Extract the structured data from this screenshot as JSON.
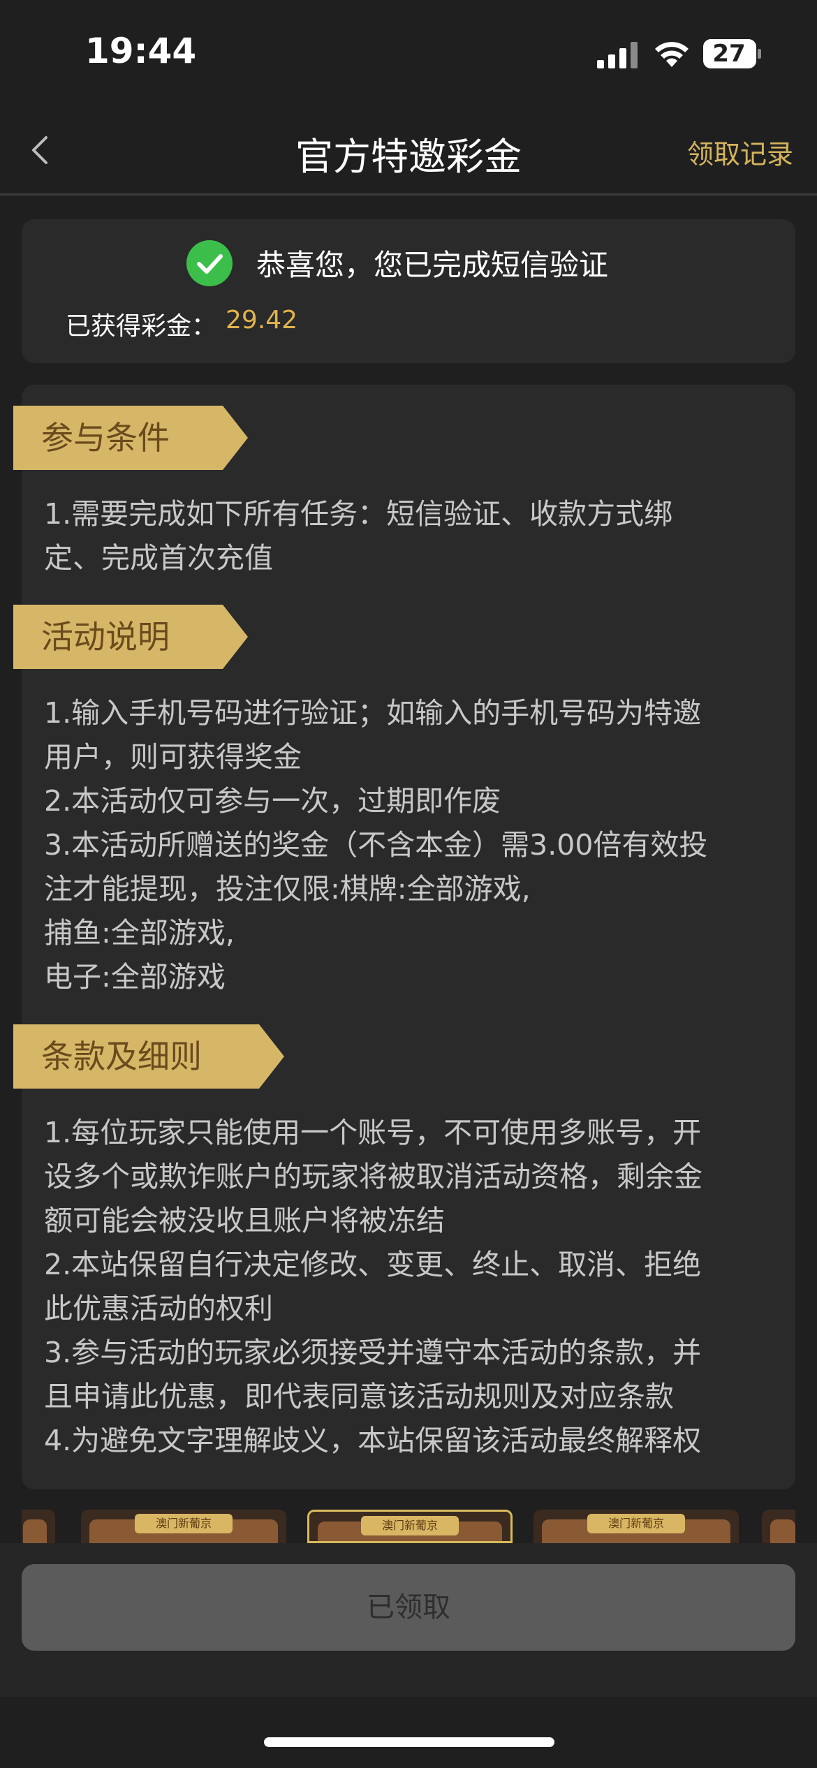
{
  "status_bar": {
    "time": "19:44",
    "battery": "27"
  },
  "nav": {
    "title": "官方特邀彩金",
    "right_link": "领取记录"
  },
  "success": {
    "message": "恭喜您，您已完成短信验证",
    "bonus_label": "已获得彩金：",
    "bonus_value": "29.42"
  },
  "sections": [
    {
      "title": "参与条件",
      "lines": [
        "1.需要完成如下所有任务：短信验证、收款方式绑",
        "定、完成首次充值"
      ]
    },
    {
      "title": "活动说明",
      "lines": [
        "1.输入手机号码进行验证；如输入的手机号码为特邀",
        "用户，则可获得奖金",
        "2.本活动仅可参与一次，过期即作废",
        "3.本活动所赠送的奖金（不含本金）需3.00倍有效投",
        "注才能提现，投注仅限:棋牌:全部游戏,",
        "捕鱼:全部游戏,",
        "电子:全部游戏"
      ]
    },
    {
      "title": "条款及细则",
      "lines": [
        "1.每位玩家只能使用一个账号，不可使用多账号，开",
        "设多个或欺诈账户的玩家将被取消活动资格，剩余金",
        "额可能会被没收且账户将被冻结",
        "2.本站保留自行决定修改、变更、终止、取消、拒绝",
        "此优惠活动的权利",
        "3.参与活动的玩家必须接受并遵守本活动的条款，并",
        "且申请此优惠，即代表同意该活动规则及对应条款",
        "4.为避免文字理解歧义，本站保留该活动最终解释权"
      ]
    }
  ],
  "thumbnails": {
    "logo_text": "澳门新葡京"
  },
  "claim_button": {
    "label": "已领取"
  },
  "icons": {
    "back": "chevron-left-icon",
    "check": "check-circle-icon",
    "signal": "cellular-signal-icon",
    "wifi": "wifi-icon",
    "battery": "battery-icon"
  },
  "colors": {
    "accent": "#d4b45c",
    "bonus": "#e2b34c",
    "success": "#3cbf4a",
    "tag_bg": "#d6b768"
  }
}
